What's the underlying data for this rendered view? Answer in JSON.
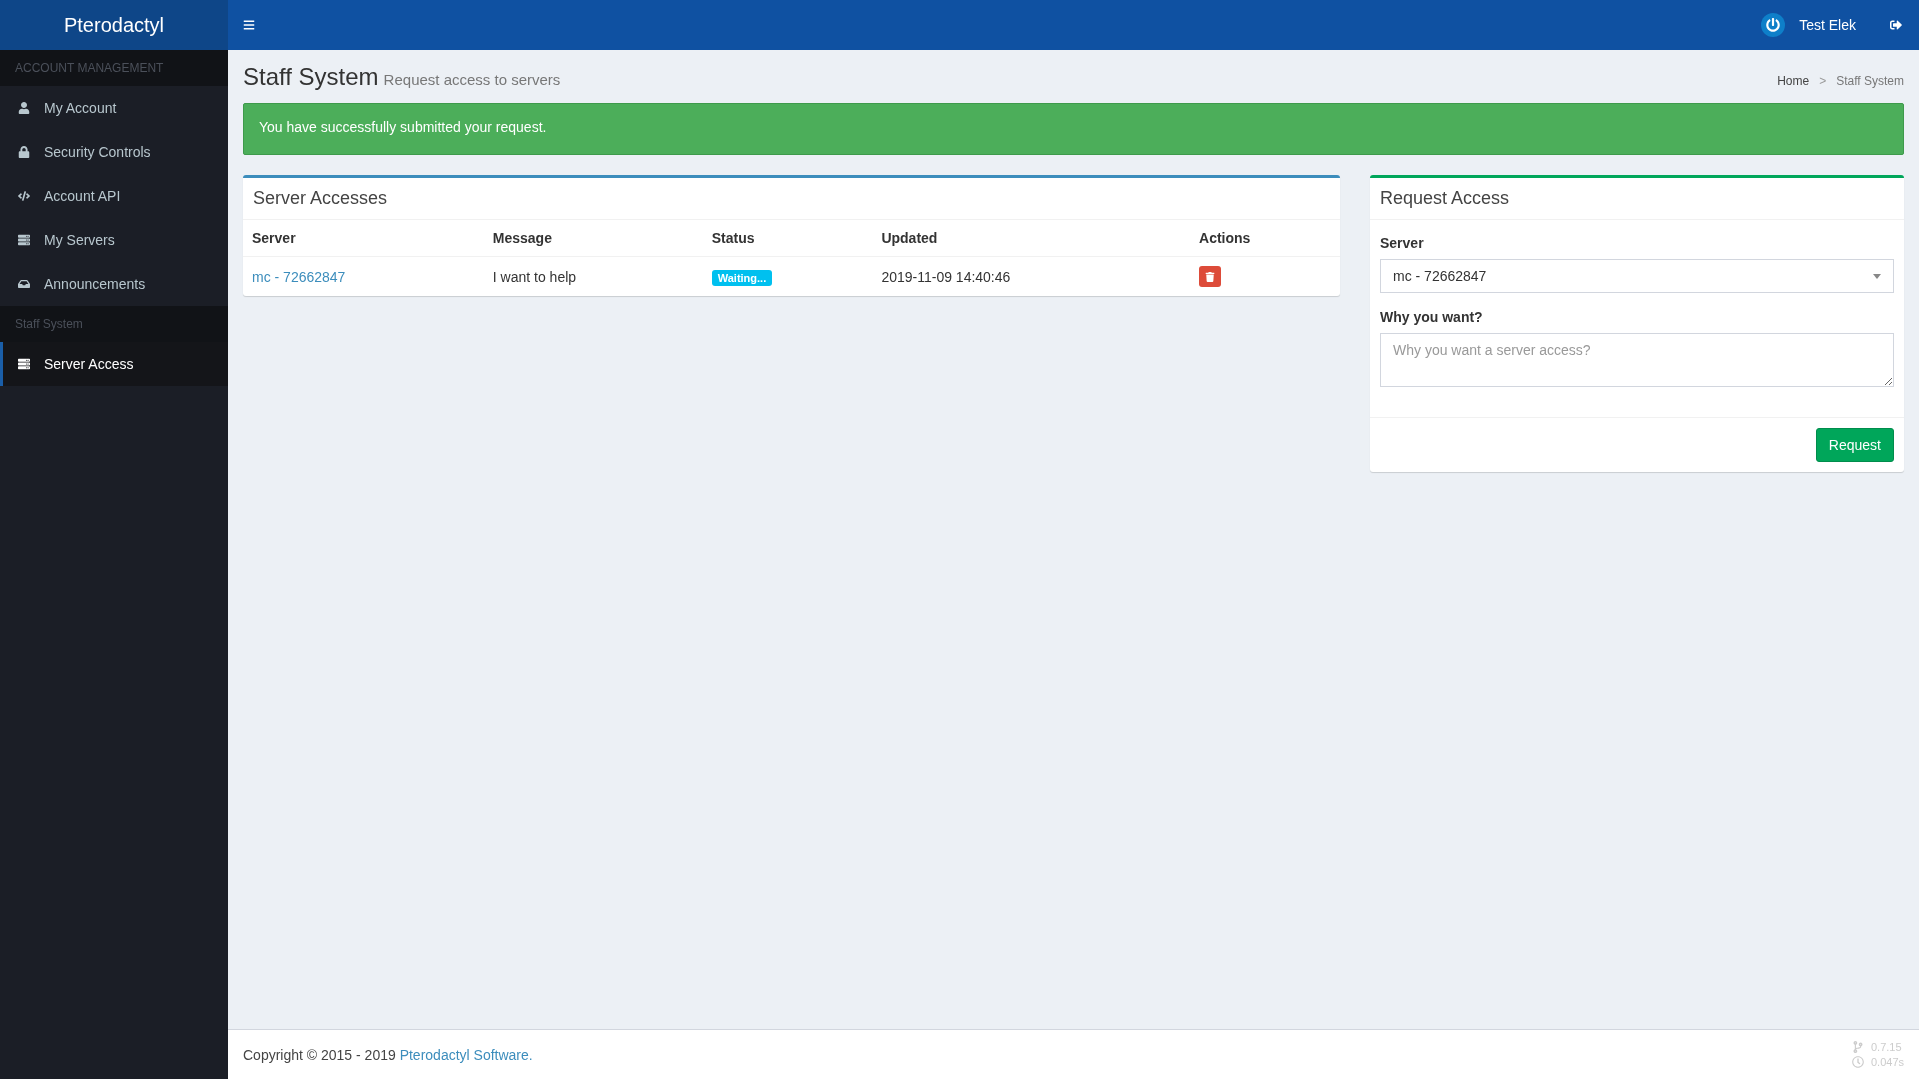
{
  "brand": "Pterodactyl",
  "user": {
    "name": "Test Elek"
  },
  "sidebar": {
    "sections": [
      {
        "header": "ACCOUNT MANAGEMENT",
        "items": [
          {
            "label": "My Account",
            "kind": "user",
            "selected": false
          },
          {
            "label": "Security Controls",
            "kind": "lock",
            "selected": false
          },
          {
            "label": "Account API",
            "kind": "code",
            "selected": false
          },
          {
            "label": "My Servers",
            "kind": "server",
            "selected": false
          },
          {
            "label": "Announcements",
            "kind": "inbox",
            "selected": false
          }
        ]
      },
      {
        "header": "Staff System",
        "items": [
          {
            "label": "Server Access",
            "kind": "server",
            "selected": true
          }
        ]
      }
    ]
  },
  "page": {
    "title": "Staff System",
    "subtitle": "Request access to servers",
    "breadcrumb_separator": ">",
    "breadcrumb": [
      {
        "label": "Home",
        "current": false
      },
      {
        "label": "Staff System",
        "current": true
      }
    ]
  },
  "alert": "You have successfully submitted your request.",
  "accesses": {
    "title": "Server Accesses",
    "columns": [
      "Server",
      "Message",
      "Status",
      "Updated",
      "Actions"
    ],
    "rows": [
      {
        "server": "mc - 72662847",
        "message": "I want to help",
        "status": "Waiting...",
        "updated": "2019-11-09 14:40:46"
      }
    ]
  },
  "request": {
    "title": "Request Access",
    "server_label": "Server",
    "server_value": "mc - 72662847",
    "reason_label": "Why you want?",
    "reason_placeholder": "Why you want a server access?",
    "button": "Request"
  },
  "footer": {
    "copyright": "Copyright © 2015 - 2019 ",
    "link": "Pterodactyl Software.",
    "version": "0.7.15",
    "time": "0.047s"
  }
}
